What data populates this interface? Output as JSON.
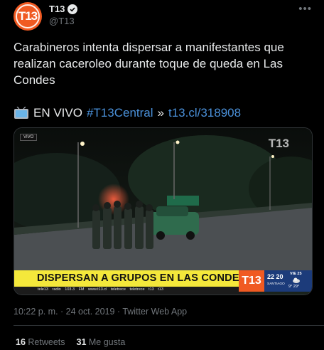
{
  "author": {
    "display_name": "T13",
    "handle": "@T13",
    "avatar_text": "T13"
  },
  "tweet": {
    "text": "Carabineros intenta dispersar a manifestantes que realizan caceroleo durante toque de queda en Las Condes",
    "live_label": "EN VIVO",
    "hashtag": "#T13Central",
    "separator": "»",
    "short_link": "t13.cl/318908"
  },
  "media": {
    "badge": "VIVO",
    "watermark": "T13",
    "ticker": "DISPERSAN A GRUPOS EN LAS CONDES",
    "subticker": "tele13 radio 103.3 FM   www.t13.cl   teletrece   teletrece   t13   t13",
    "channel_logo": "T13",
    "clock_time": "22 20",
    "clock_city": "SANTIAGO",
    "weather_date": "VIE 25",
    "weather_temp": "9° 29°"
  },
  "meta": {
    "timestamp": "10:22 p. m. · 24 oct. 2019 · Twitter Web App"
  },
  "stats": {
    "retweets_count": "16",
    "retweets_label": "Retweets",
    "likes_count": "31",
    "likes_label": "Me gusta"
  },
  "colors": {
    "background": "#000000",
    "link": "#4a90d9",
    "brand": "#f05a22",
    "ticker": "#f4e83b"
  }
}
